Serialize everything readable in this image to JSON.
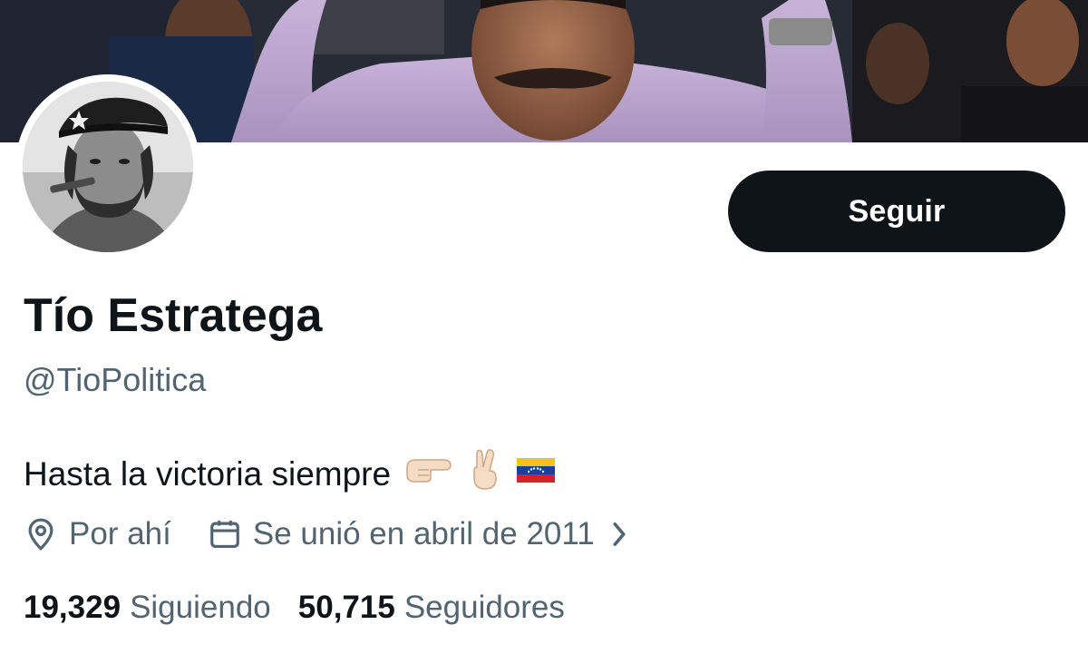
{
  "banner": {
    "description_icon": "header-photo"
  },
  "avatar": {
    "icon": "profile-photo"
  },
  "profile": {
    "display_name": "Tío Estratega",
    "handle": "@TioPolitica",
    "bio_text": "Hasta la victoria siempre",
    "bio_emojis": [
      "pointing-right-emoji",
      "victory-hand-emoji",
      "venezuela-flag-emoji"
    ]
  },
  "actions": {
    "follow_label": "Seguir"
  },
  "meta": {
    "location": "Por ahí",
    "joined": "Se unió en abril de 2011"
  },
  "stats": {
    "following_count": "19,329",
    "following_label": "Siguiendo",
    "followers_count": "50,715",
    "followers_label": "Seguidores"
  },
  "colors": {
    "text_primary": "#0f1419",
    "text_secondary": "#536471",
    "button_bg": "#0f1419",
    "button_text": "#ffffff",
    "background": "#ffffff"
  }
}
